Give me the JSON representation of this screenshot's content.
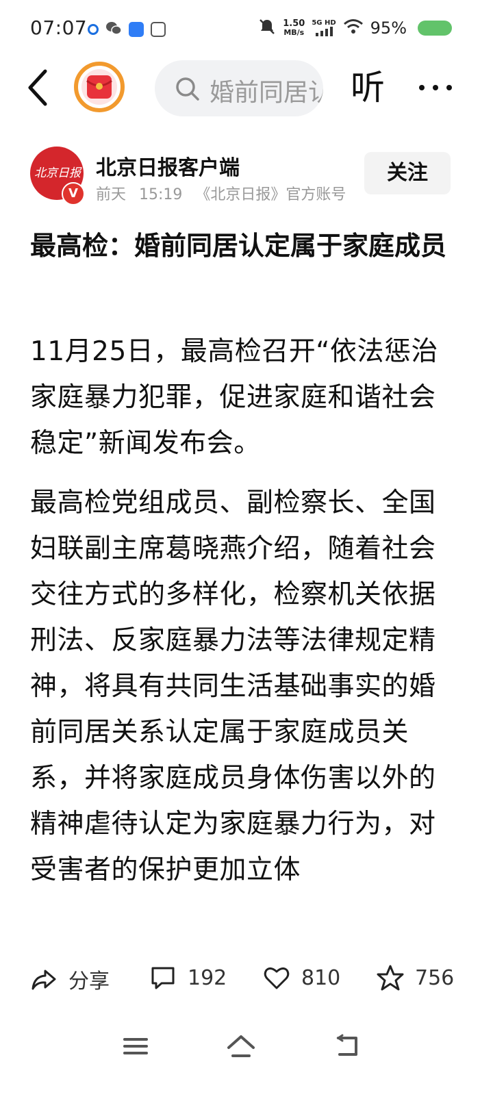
{
  "status_bar": {
    "time": "07:07",
    "net_speed_value": "1.50",
    "net_speed_unit": "MB/s",
    "network_gen": "5G HD",
    "battery_pct": "95%",
    "battery_color": "#62c36a"
  },
  "nav": {
    "search_text": "婚前同居认定属于家庭成员",
    "listen_label": "听"
  },
  "author": {
    "avatar_text": "北京日报",
    "verified_mark": "V",
    "name": "北京日报客户端",
    "date": "前天",
    "time": "15:19",
    "account_desc": "《北京日报》官方账号",
    "follow_label": "关注"
  },
  "article": {
    "title": "最高检：婚前同居认定属于家庭成员",
    "paragraphs": [
      "11月25日，最高检召开“依法惩治家庭暴力犯罪，促进家庭和谐社会稳定”新闻发布会。",
      "最高检党组成员、副检察长、全国妇联副主席葛晓燕介绍，随着社会交往方式的多样化，检察机关依据刑法、反家庭暴力法等法律规定精神，将具有共同生活基础事实的婚前同居关系认定属于家庭成员关系，并将家庭成员身体伤害以外的精神虐待认定为家庭暴力行为，对受害者的保护更加立体"
    ]
  },
  "actions": {
    "share_label": "分享",
    "comments_count": "192",
    "likes_count": "810",
    "favorites_count": "756"
  },
  "colors": {
    "accent_red": "#d4262c",
    "follow_bg": "#f3f3f3",
    "search_bg": "#f1f2f4"
  }
}
